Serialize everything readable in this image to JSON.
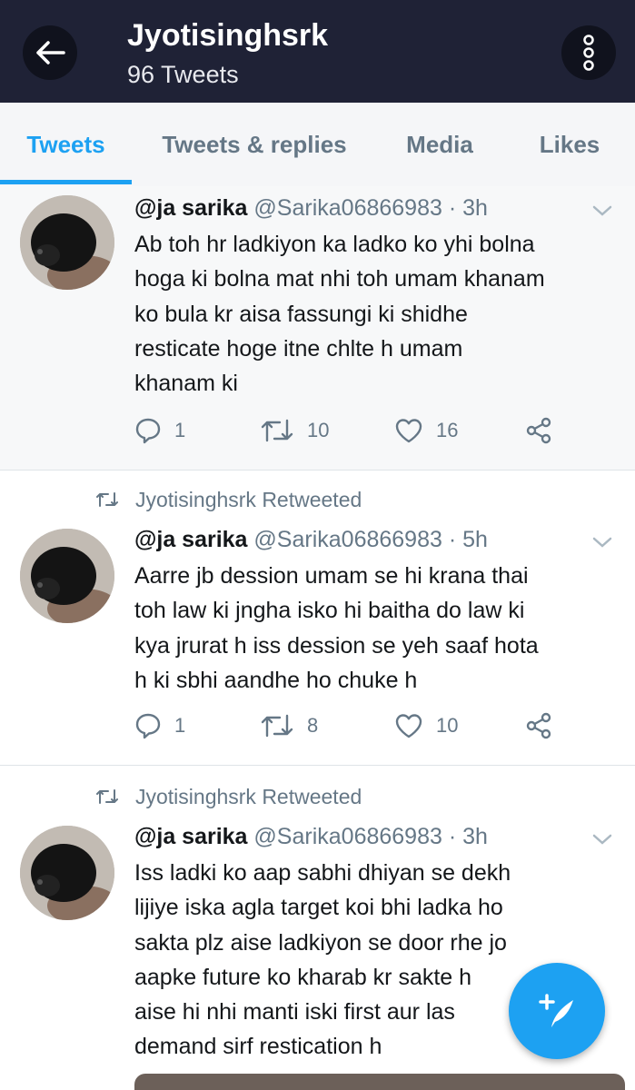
{
  "header": {
    "title": "Jyotisinghsrk",
    "subtitle": "96 Tweets",
    "back_icon": "arrow-left-icon",
    "more_icon": "more-vertical-icon"
  },
  "tabs": [
    {
      "label": "Tweets",
      "active": true
    },
    {
      "label": "Tweets & replies",
      "active": false
    },
    {
      "label": "Media",
      "active": false
    },
    {
      "label": "Likes",
      "active": false
    }
  ],
  "colors": {
    "accent": "#1da1f2",
    "header_bg": "#1f2236",
    "muted": "#657786"
  },
  "tweets": [
    {
      "retweet_label": "",
      "name": "@ja sarika",
      "handle": "@Sarika06866983",
      "time": "3h",
      "text": "Ab toh hr ladkiyon ka ladko ko yhi bolna\nhoga ki bolna mat nhi toh umam khanam\nko bula kr aisa fassungi ki shidhe\nresticate hoge itne chlte h umam\nkhanam ki",
      "replies": "1",
      "retweets": "10",
      "likes": "16"
    },
    {
      "retweet_label": "Jyotisinghsrk Retweeted",
      "name": "@ja sarika",
      "handle": "@Sarika06866983",
      "time": "5h",
      "text": "Aarre jb dession umam se hi krana thai\ntoh law ki jngha isko hi baitha do law ki\nkya jrurat h iss dession se yeh saaf hota\nh ki sbhi aandhe ho chuke h",
      "replies": "1",
      "retweets": "8",
      "likes": "10"
    },
    {
      "retweet_label": "Jyotisinghsrk Retweeted",
      "name": "@ja sarika",
      "handle": "@Sarika06866983",
      "time": "3h",
      "text": "Iss ladki ko aap sabhi dhiyan se dekh\nlijiye iska agla target koi bhi ladka ho\nsakta plz aise ladkiyon se door rhe jo\naapke future ko kharab kr sakte h\naise hi nhi manti iski first aur las\ndemand sirf restication h",
      "replies": "",
      "retweets": "",
      "likes": ""
    }
  ],
  "fab": {
    "icon": "compose-tweet-icon"
  }
}
